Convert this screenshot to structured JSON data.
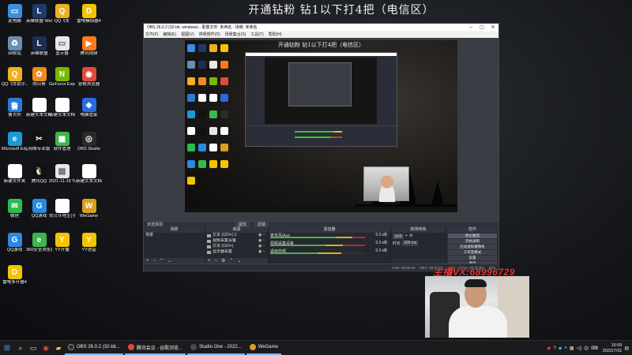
{
  "overlay_title": "开通钻粉 钻1以下打4把（电信区）",
  "desktop": {
    "icons": [
      {
        "label": "此电脑",
        "icon": "computer-icon",
        "color": "#3a8de0",
        "glyph": "▭"
      },
      {
        "label": "英雄联盟 WeGame版",
        "icon": "lol-wegame-icon",
        "color": "#1e3a6a",
        "glyph": "L"
      },
      {
        "label": "QQ飞车",
        "icon": "qq-speed-icon",
        "color": "#f0b020",
        "glyph": "Q"
      },
      {
        "label": "雷电模拟器4",
        "icon": "ldplayer-icon",
        "color": "#f5c400",
        "glyph": "D"
      },
      {
        "label": "回收站",
        "icon": "recycle-bin-icon",
        "color": "#6a8fb0",
        "glyph": "♻"
      },
      {
        "label": "英雄联盟",
        "icon": "lol-icon",
        "color": "#1b2f52",
        "glyph": "L"
      },
      {
        "label": "显示器",
        "icon": "monitor-icon",
        "color": "#e8e8e8",
        "glyph": "▭"
      },
      {
        "label": "腾讯视频",
        "icon": "tencent-video-icon",
        "color": "#ff7a1a",
        "glyph": "▶"
      },
      {
        "label": "QQ飞车助手工具",
        "icon": "qq-speed-tool-icon",
        "color": "#f0b020",
        "glyph": "Q"
      },
      {
        "label": "向日葵",
        "icon": "sunflower-icon",
        "color": "#f08a1a",
        "glyph": "✿"
      },
      {
        "label": "GeForce Experience",
        "icon": "geforce-icon",
        "color": "#76b900",
        "glyph": "N"
      },
      {
        "label": "谷歌浏览器",
        "icon": "chrome-icon",
        "color": "#e04a3a",
        "glyph": "◉"
      },
      {
        "label": "鲁大师",
        "icon": "ludashi-icon",
        "color": "#2a7ad8",
        "glyph": "鲁"
      },
      {
        "label": "新建文本文档",
        "icon": "text-file-icon",
        "color": "#ffffff",
        "glyph": ""
      },
      {
        "label": "新建文本文档(2)",
        "icon": "text-file-icon",
        "color": "#ffffff",
        "glyph": ""
      },
      {
        "label": "电脑管家",
        "icon": "pc-manager-icon",
        "color": "#2a6ae0",
        "glyph": "◈"
      },
      {
        "label": "Microsoft Edge",
        "icon": "edge-icon",
        "color": "#1c9ad8",
        "glyph": "e"
      },
      {
        "label": "剪映专业版",
        "icon": "capcut-icon",
        "color": "#111111",
        "glyph": "✂"
      },
      {
        "label": "软件管理",
        "icon": "software-manager-icon",
        "color": "#3cb84a",
        "glyph": "▦"
      },
      {
        "label": "OBS Studio",
        "icon": "obs-icon",
        "color": "#2a2a2a",
        "glyph": "◎"
      },
      {
        "label": "新建文件夹",
        "icon": "text-file-icon",
        "color": "#ffffff",
        "glyph": ""
      },
      {
        "label": "腾讯QQ",
        "icon": "qq-icon",
        "color": "#111111",
        "glyph": "🐧"
      },
      {
        "label": "2021-11-19 Team AR...",
        "icon": "file-icon",
        "color": "#e8e8e8",
        "glyph": "▤"
      },
      {
        "label": "新建文本文档(4)",
        "icon": "text-file-icon",
        "color": "#ffffff",
        "glyph": ""
      },
      {
        "label": "微信",
        "icon": "wechat-icon",
        "color": "#2dbb4e",
        "glyph": "✉"
      },
      {
        "label": "QQ游戏",
        "icon": "qq-game-icon",
        "color": "#2a8ae0",
        "glyph": "G"
      },
      {
        "label": "坎贝斗地主(手游电脑版)",
        "icon": "text-file-icon",
        "color": "#ffffff",
        "glyph": ""
      },
      {
        "label": "WeGame",
        "icon": "wegame-icon",
        "color": "#d8a020",
        "glyph": "W"
      },
      {
        "label": "QQ游戏",
        "icon": "qq-game-icon",
        "color": "#2a8ae0",
        "glyph": "G"
      },
      {
        "label": "360安全浏览器",
        "icon": "360-browser-icon",
        "color": "#3cb84a",
        "glyph": "e"
      },
      {
        "label": "YY开播",
        "icon": "yy-live-icon",
        "color": "#f5c400",
        "glyph": "Y"
      },
      {
        "label": "YY语音",
        "icon": "yy-voice-icon",
        "color": "#f5c400",
        "glyph": "Y"
      },
      {
        "label": "雷电多开器4",
        "icon": "ldplayer-multi-icon",
        "color": "#f5c400",
        "glyph": "D"
      }
    ]
  },
  "obs": {
    "title": "OBS 26.0.2 (32-bit, windows) - 配置文件: 未命名 - 场景: 未命名",
    "menu": [
      "文件(F)",
      "编辑(E)",
      "视图(V)",
      "停靠部件(D)",
      "场景集合(S)",
      "工具(T)",
      "帮助(H)"
    ],
    "nested_title": "开通钻粉 钻1以下打4把（电信区）",
    "dockbar": {
      "no_source": "未选择源",
      "properties": "属性",
      "filters": "滤镜"
    },
    "scenes": {
      "header": "场景",
      "items": [
        "场景"
      ]
    },
    "sources": {
      "header": "来源",
      "items": [
        {
          "name": "文本 (GDI+) 2",
          "icon": "text-source-icon"
        },
        {
          "name": "视频采集设备",
          "icon": "camera-source-icon"
        },
        {
          "name": "文本 (GDI+)",
          "icon": "text-source-icon"
        },
        {
          "name": "显示器采集",
          "icon": "display-source-icon"
        }
      ]
    },
    "mixer": {
      "header": "混音器",
      "channels": [
        {
          "name": "麦克风/Aux",
          "db": "0.0 dB"
        },
        {
          "name": "视频采集设备",
          "db": "0.0 dB"
        },
        {
          "name": "桌面音频",
          "db": "0.0 dB"
        }
      ]
    },
    "transitions": {
      "header": "转场特效",
      "type": "淡出",
      "duration_label": "时长",
      "duration": "300 ms"
    },
    "controls": {
      "header": "控件",
      "buttons": [
        "停止推流",
        "开始录制",
        "启动虚拟摄像机",
        "工作室模式",
        "设置",
        "退出"
      ]
    },
    "status": {
      "live": "LIVE: 00:00:00",
      "rec": "REC: 00:00:00",
      "cpu": "CPU: 12.5%, 30.00 fps",
      "kbps": "kb/s"
    }
  },
  "watermark": "主播VX:68996729",
  "taskbar": {
    "apps": [
      {
        "label": "OBS 26.0.2 (32-bit...",
        "icon": "obs-icon",
        "color": "#2a2a2a"
      },
      {
        "label": "腾讯会议 - 谷歌浏览...",
        "icon": "chrome-icon",
        "color": "#e04a3a"
      },
      {
        "label": "Studio One - 2022...",
        "icon": "studio-one-icon",
        "color": "#4a4a4a"
      },
      {
        "label": "WeGame",
        "icon": "wegame-icon",
        "color": "#d8a020"
      }
    ],
    "tray_lang": "中",
    "time": "16:59",
    "date": "2022/7/31"
  }
}
